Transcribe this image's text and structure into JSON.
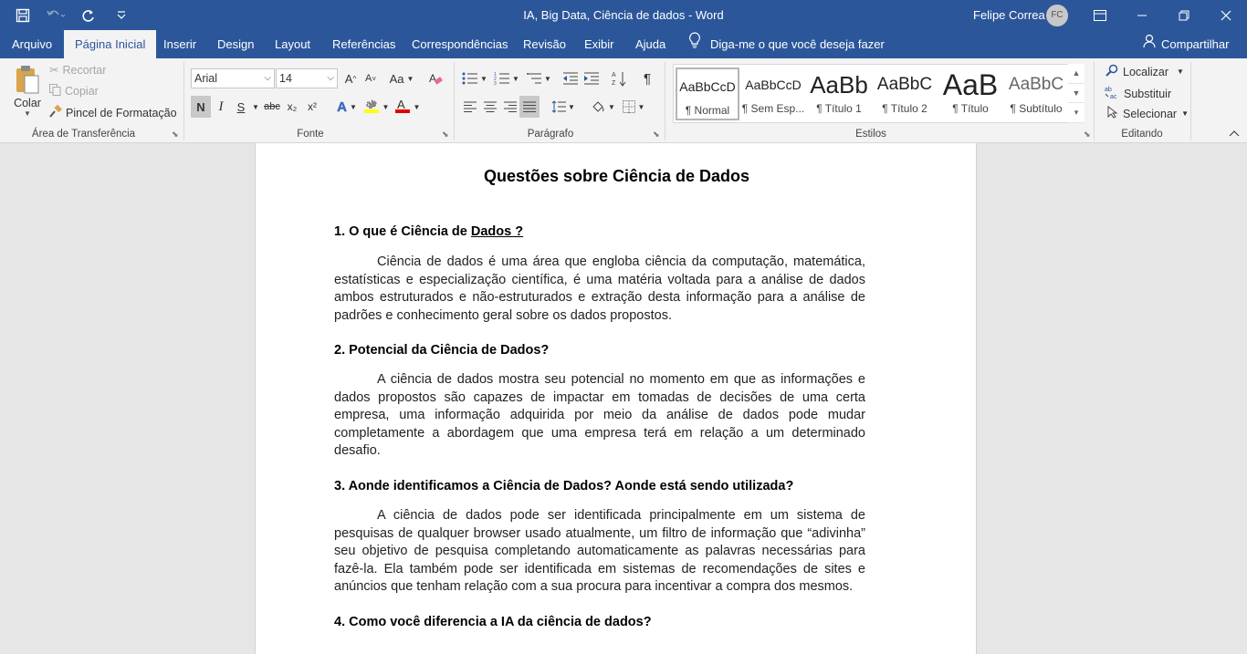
{
  "window": {
    "title": "IA, Big Data, Ciência de dados  -  Word",
    "user": "Felipe Correa",
    "avatar_initials": "FC"
  },
  "menu": {
    "tabs": [
      "Arquivo",
      "Página Inicial",
      "Inserir",
      "Design",
      "Layout",
      "Referências",
      "Correspondências",
      "Revisão",
      "Exibir",
      "Ajuda"
    ],
    "active_tab": "Página Inicial",
    "tell_me": "Diga-me o que você deseja fazer",
    "share": "Compartilhar"
  },
  "ribbon": {
    "clipboard": {
      "label": "Área de Transferência",
      "paste": "Colar",
      "cut": "Recortar",
      "copy": "Copiar",
      "format_painter": "Pincel de Formatação"
    },
    "font": {
      "label": "Fonte",
      "font_name": "Arial",
      "font_size": "14",
      "bold": "N",
      "italic": "I",
      "underline": "S",
      "strike": "abc",
      "sub": "x₂",
      "sup": "x²",
      "case": "Aa"
    },
    "paragraph": {
      "label": "Parágrafo"
    },
    "styles": {
      "label": "Estilos",
      "items": [
        {
          "preview": "AaBbCcD",
          "name": "¶ Normal"
        },
        {
          "preview": "AaBbCcD",
          "name": "¶ Sem Esp..."
        },
        {
          "preview": "AaBb",
          "name": "¶ Título 1"
        },
        {
          "preview": "AaBbC",
          "name": "¶ Título 2"
        },
        {
          "preview": "AaB",
          "name": "¶ Título"
        },
        {
          "preview": "AaBbC",
          "name": "¶ Subtítulo"
        }
      ]
    },
    "editing": {
      "label": "Editando",
      "find": "Localizar",
      "replace": "Substituir",
      "select": "Selecionar"
    }
  },
  "document": {
    "title": "Questões sobre Ciência de Dados",
    "q1_prefix": "1. O que é Ciência de ",
    "q1_link": "Dados ?",
    "a1": "Ciência de dados é uma área que engloba ciência da computação, matemática, estatísticas e especialização científica, é uma matéria voltada para a análise de dados ambos estruturados e não-estruturados e extração desta informação para a análise de padrões e conhecimento geral sobre os dados propostos.",
    "q2": "2. Potencial da Ciência de Dados?",
    "a2": "A ciência de dados mostra seu potencial no momento em que as informações e dados propostos são capazes de impactar em tomadas de decisões de uma certa empresa, uma informação adquirida por meio da análise de dados pode mudar completamente a abordagem que uma empresa terá em relação a um determinado desafio.",
    "q3": "3. Aonde identificamos a Ciência de Dados? Aonde está sendo utilizada?",
    "a3": "A ciência de dados pode ser identificada principalmente em um sistema de pesquisas de qualquer browser usado atualmente, um filtro de informação que “adivinha” seu objetivo de pesquisa completando automaticamente as palavras necessárias para fazê-la. Ela também pode ser identificada em sistemas de recomendações de sites e anúncios que tenham relação com a sua procura para incentivar a compra dos mesmos.",
    "q4": "4. Como você diferencia a IA da ciência de dados?"
  },
  "colors": {
    "brand": "#2b579a",
    "ribbon_bg": "#f3f3f3",
    "highlight": "#ffff00",
    "font_color": "#e00000"
  }
}
